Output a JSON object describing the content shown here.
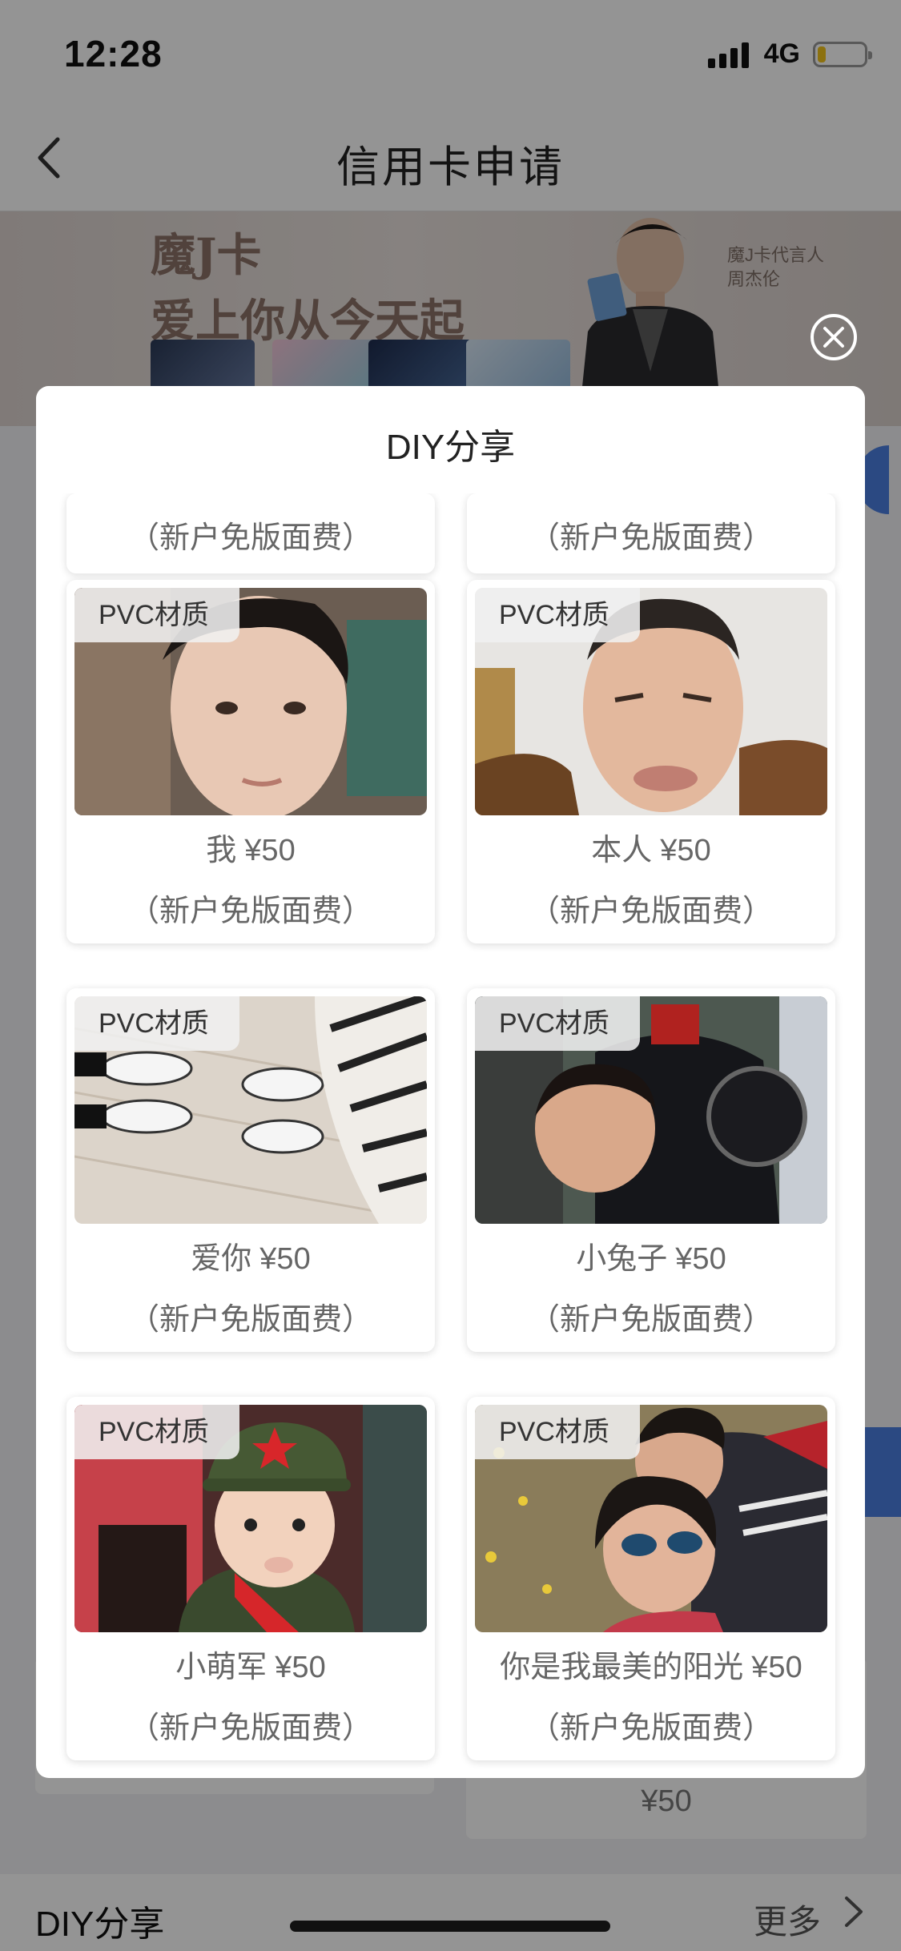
{
  "status_bar": {
    "time": "12:28",
    "network": "4G",
    "battery_level": 0.18
  },
  "nav": {
    "title": "信用卡申请"
  },
  "banner": {
    "slogan_line1": "魔J卡",
    "slogan_line2": "爱上你从今天起",
    "endorser_line1": "魔J卡代言人",
    "endorser_line2": "周杰伦"
  },
  "modal": {
    "title": "DIY分享",
    "close_icon": "close-circle-icon",
    "partial_notes": [
      "（新户免版面费）",
      "（新户免版面费）"
    ],
    "cards": [
      {
        "badge": "PVC材质",
        "name": "我",
        "price": "¥50",
        "note": "（新户免版面费）"
      },
      {
        "badge": "PVC材质",
        "name": "本人",
        "price": "¥50",
        "note": "（新户免版面费）"
      },
      {
        "badge": "PVC材质",
        "name": "爱你",
        "price": "¥50",
        "note": "（新户免版面费）"
      },
      {
        "badge": "PVC材质",
        "name": "小兔子",
        "price": "¥50",
        "note": "（新户免版面费）"
      },
      {
        "badge": "PVC材质",
        "name": "小萌军",
        "price": "¥50",
        "note": "（新户免版面费）"
      },
      {
        "badge": "PVC材质",
        "name": "你是我最美的阳光",
        "price": "¥50",
        "note": "（新户免版面费）"
      }
    ]
  },
  "background": {
    "price": "¥50"
  },
  "bottom_section": {
    "title": "DIY分享",
    "more": "更多"
  },
  "colors": {
    "mask": "#000000",
    "badge_bg": "#f0f0f0",
    "banner_text": "#8c7368"
  }
}
